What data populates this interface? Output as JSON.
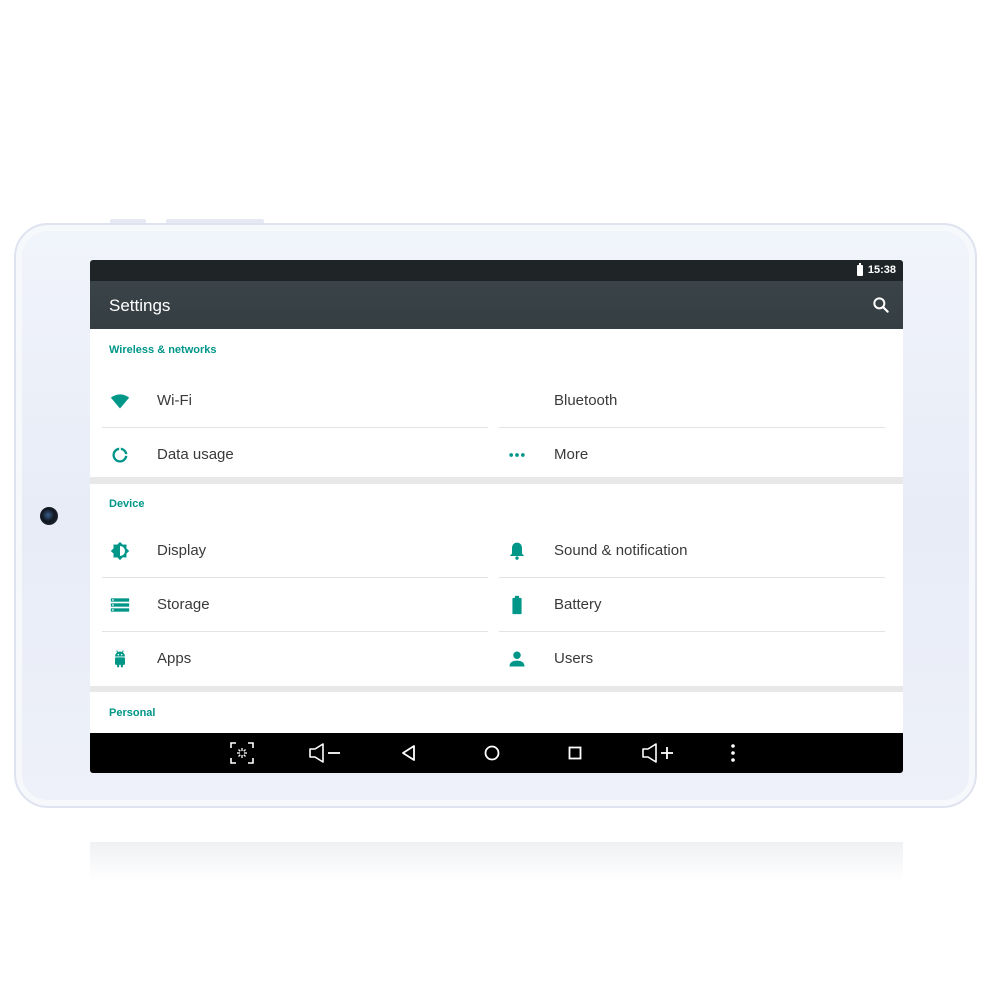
{
  "status": {
    "time": "15:38"
  },
  "appbar": {
    "title": "Settings",
    "search_icon": "search-icon"
  },
  "sections": {
    "wireless": {
      "title": "Wireless & networks",
      "items": [
        {
          "label": "Wi-Fi",
          "icon": "wifi-icon"
        },
        {
          "label": "Bluetooth",
          "icon": ""
        },
        {
          "label": "Data usage",
          "icon": "data-usage-icon"
        },
        {
          "label": "More",
          "icon": "more-icon"
        }
      ]
    },
    "device": {
      "title": "Device",
      "items": [
        {
          "label": "Display",
          "icon": "brightness-icon"
        },
        {
          "label": "Sound & notification",
          "icon": "bell-icon"
        },
        {
          "label": "Storage",
          "icon": "storage-icon"
        },
        {
          "label": "Battery",
          "icon": "battery-icon"
        },
        {
          "label": "Apps",
          "icon": "android-icon"
        },
        {
          "label": "Users",
          "icon": "user-icon"
        }
      ]
    },
    "personal": {
      "title": "Personal"
    }
  },
  "navbar": {
    "buttons": [
      "screenshot-icon",
      "volume-down-icon",
      "back-icon",
      "home-icon",
      "recents-icon",
      "volume-up-icon",
      "overflow-menu-icon"
    ]
  },
  "colors": {
    "accent": "#009688",
    "appbar": "#37414",
    "statusbar": "#1f2426",
    "navbar": "#000000"
  }
}
